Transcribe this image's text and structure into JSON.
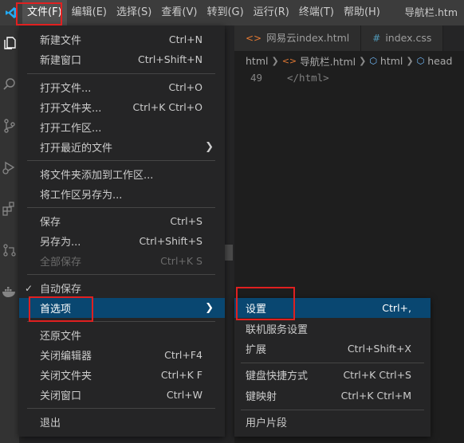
{
  "menubar": {
    "items": [
      {
        "label": "文件(F)"
      },
      {
        "label": "编辑(E)"
      },
      {
        "label": "选择(S)"
      },
      {
        "label": "查看(V)"
      },
      {
        "label": "转到(G)"
      },
      {
        "label": "运行(R)"
      },
      {
        "label": "终端(T)"
      },
      {
        "label": "帮助(H)"
      }
    ],
    "window_title": "导航栏.htm"
  },
  "activity_bar": {
    "icons": [
      "explorer-icon",
      "search-icon",
      "source-control-icon",
      "run-debug-icon",
      "extensions-icon",
      "remote-explorer-icon",
      "docker-icon"
    ]
  },
  "tabs": [
    {
      "label": "网易云index.html",
      "icon": "html-file-icon"
    },
    {
      "label": "index.css",
      "icon": "css-file-icon"
    }
  ],
  "breadcrumb": {
    "items": [
      "html",
      "导航栏.html",
      "html",
      "head"
    ]
  },
  "editor": {
    "line_number": "49",
    "code": "</html>"
  },
  "file_menu": {
    "items": [
      {
        "label": "新建文件",
        "shortcut": "Ctrl+N"
      },
      {
        "label": "新建窗口",
        "shortcut": "Ctrl+Shift+N"
      },
      {
        "label": "打开文件...",
        "shortcut": "Ctrl+O"
      },
      {
        "label": "打开文件夹...",
        "shortcut": "Ctrl+K Ctrl+O"
      },
      {
        "label": "打开工作区..."
      },
      {
        "label": "打开最近的文件"
      },
      {
        "label": "将文件夹添加到工作区..."
      },
      {
        "label": "将工作区另存为..."
      },
      {
        "label": "保存",
        "shortcut": "Ctrl+S"
      },
      {
        "label": "另存为...",
        "shortcut": "Ctrl+Shift+S"
      },
      {
        "label": "全部保存",
        "shortcut": "Ctrl+K S"
      },
      {
        "label": "自动保存",
        "checked": true
      },
      {
        "label": "首选项"
      },
      {
        "label": "还原文件"
      },
      {
        "label": "关闭编辑器",
        "shortcut": "Ctrl+F4"
      },
      {
        "label": "关闭文件夹",
        "shortcut": "Ctrl+K F"
      },
      {
        "label": "关闭窗口",
        "shortcut": "Ctrl+W"
      },
      {
        "label": "退出"
      }
    ]
  },
  "preferences_menu": {
    "items": [
      {
        "label": "设置",
        "shortcut": "Ctrl+,"
      },
      {
        "label": "联机服务设置"
      },
      {
        "label": "扩展",
        "shortcut": "Ctrl+Shift+X"
      },
      {
        "label": "键盘快捷方式",
        "shortcut": "Ctrl+K Ctrl+S"
      },
      {
        "label": "键映射",
        "shortcut": "Ctrl+K Ctrl+M"
      },
      {
        "label": "用户片段"
      }
    ]
  },
  "colors": {
    "menu_highlight": "#094771",
    "annotation": "#e02020",
    "menubar_bg": "#3c3c3c",
    "menu_bg": "#252526"
  }
}
